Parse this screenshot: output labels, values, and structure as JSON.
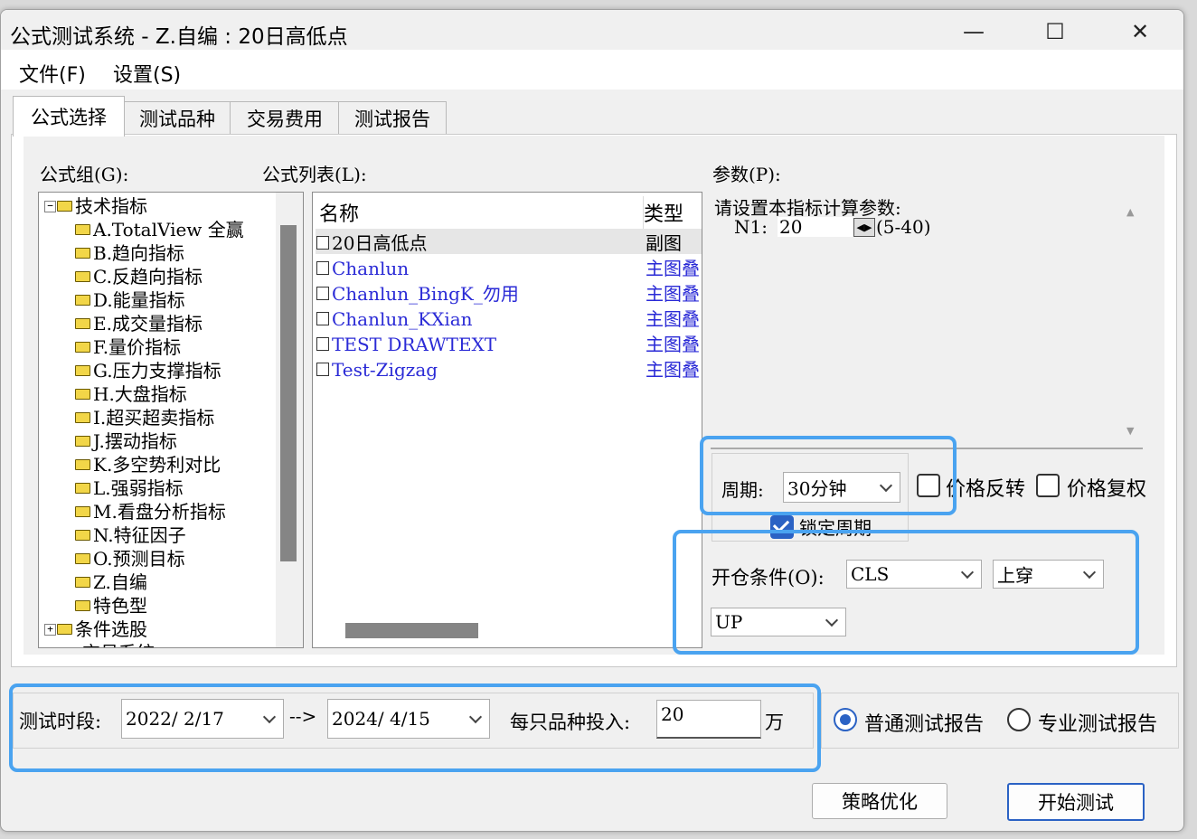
{
  "window": {
    "title": "公式测试系统 - Z.自编 : 20日高低点",
    "minimize_glyph": "—",
    "maximize_glyph": "☐",
    "close_glyph": "✕"
  },
  "menu": {
    "file": "文件(F)",
    "settings": "设置(S)"
  },
  "tabs": [
    {
      "label": "公式选择",
      "active": true
    },
    {
      "label": "测试品种",
      "active": false
    },
    {
      "label": "交易费用",
      "active": false
    },
    {
      "label": "测试报告",
      "active": false
    }
  ],
  "formula_group": {
    "label": "公式组(G):",
    "root": "技术指标",
    "items": [
      "A.TotalView 全赢",
      "B.趋向指标",
      "C.反趋向指标",
      "D.能量指标",
      "E.成交量指标",
      "F.量价指标",
      "G.压力支撑指标",
      "H.大盘指标",
      "I.超买超卖指标",
      "J.摆动指标",
      "K.多空势利对比",
      "L.强弱指标",
      "M.看盘分析指标",
      "N.特征因子",
      "O.预测目标",
      "Z.自编",
      "特色型"
    ],
    "root2": "条件选股",
    "partial": "交易系统"
  },
  "formula_list": {
    "label": "公式列表(L):",
    "col_name": "名称",
    "col_type": "类型",
    "rows": [
      {
        "name": "20日高低点",
        "type": "副图"
      },
      {
        "name": "Chanlun",
        "type": "主图叠"
      },
      {
        "name": "Chanlun_BingK_勿用",
        "type": "主图叠"
      },
      {
        "name": "Chanlun_KXian",
        "type": "主图叠"
      },
      {
        "name": "TEST DRAWTEXT",
        "type": "主图叠"
      },
      {
        "name": "Test-Zigzag",
        "type": "主图叠"
      }
    ]
  },
  "params": {
    "label": "参数(P):",
    "prompt": "请设置本指标计算参数:",
    "n1_label": "N1:",
    "n1_value": "20",
    "n1_range": "(5-40)"
  },
  "period": {
    "label": "周期:",
    "value": "30分钟",
    "lock_label": "锁定周期",
    "lock_checked": true
  },
  "price_reverse": {
    "label": "价格反转",
    "checked": false
  },
  "price_adjust": {
    "label": "价格复权",
    "checked": false
  },
  "open_condition": {
    "label": "开仓条件(O):",
    "field": "CLS",
    "operator": "上穿",
    "target": "UP"
  },
  "test_period": {
    "label": "测试时段:",
    "start": "2022/ 2/17",
    "arrow": "-->",
    "end": "2024/ 4/15",
    "invest_label": "每只品种投入:",
    "invest_value": "20",
    "unit": "万"
  },
  "report": {
    "normal": "普通测试报告",
    "pro": "专业测试报告",
    "selected": "normal"
  },
  "buttons": {
    "optimize": "策略优化",
    "start": "开始测试"
  },
  "colors": {
    "highlight": "#4aa3f0",
    "link_blue": "#2a2ad6",
    "check_blue": "#2b62c4"
  }
}
